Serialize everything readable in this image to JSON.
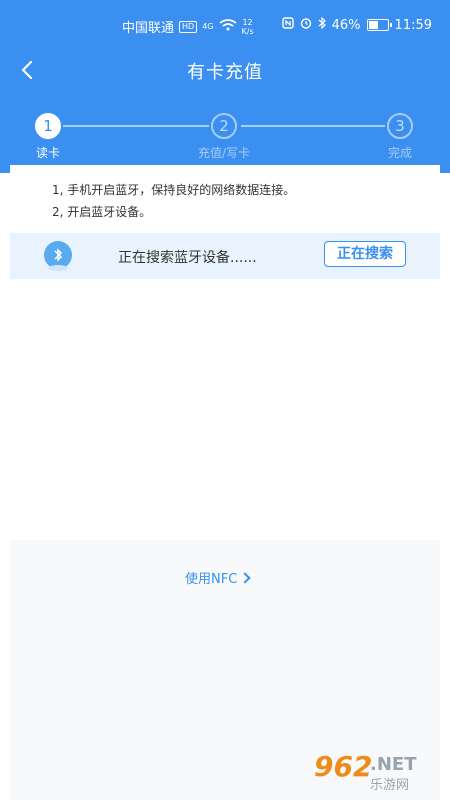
{
  "status_bar": {
    "carrier": "中国联通",
    "hd_badge": "HD",
    "net_type": "4G",
    "speed_value": "12",
    "speed_unit": "K/s",
    "battery": "46%",
    "time": "11:59"
  },
  "header": {
    "title": "有卡充值"
  },
  "steps": [
    {
      "number": "1",
      "label": "读卡"
    },
    {
      "number": "2",
      "label": "充值/写卡"
    },
    {
      "number": "3",
      "label": "完成"
    }
  ],
  "instructions": [
    "1, 手机开启蓝牙，保持良好的网络数据连接。",
    "2, 开启蓝牙设备。"
  ],
  "search": {
    "status_text": "正在搜索蓝牙设备......",
    "button_label": "正在搜索"
  },
  "nfc": {
    "link_label": "使用NFC"
  },
  "watermark": {
    "number": "962",
    "suffix": ".NET",
    "site": "乐游网"
  },
  "colors": {
    "primary": "#3a8ff0",
    "inactive_step": "#a9cdf7",
    "search_bg": "#e9f3fd"
  }
}
